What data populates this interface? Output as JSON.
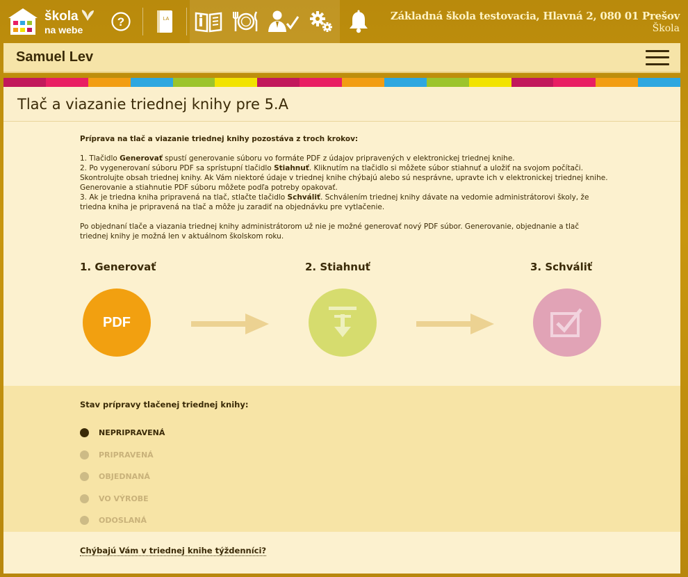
{
  "brand": {
    "line1": "škola",
    "line2": "na webe"
  },
  "topnav": [
    {
      "name": "help-icon"
    },
    {
      "name": "class-book-icon",
      "badge": "LA"
    },
    {
      "name": "reading-book-icon"
    },
    {
      "name": "dining-icon"
    },
    {
      "name": "teacher-check-icon"
    },
    {
      "name": "settings-gears-icon"
    },
    {
      "name": "notification-bell-icon"
    }
  ],
  "school": {
    "name": "Základná škola testovacia, Hlavná 2, 080 01 Prešov",
    "role": "Škola"
  },
  "user": {
    "name": "Samuel Lev"
  },
  "strip_colors": [
    "#c2185b",
    "#e91e63",
    "#f29d12",
    "#2ea7e0",
    "#9cc42c",
    "#f2e300",
    "#c2185b",
    "#e91e63",
    "#f29d12",
    "#2ea7e0",
    "#9cc42c",
    "#f2e300",
    "#c2185b",
    "#e91e63",
    "#f29d12",
    "#2ea7e0"
  ],
  "page": {
    "title": "Tlač a viazanie triednej knihy pre 5.A"
  },
  "instructions": {
    "intro": "Príprava na tlač a viazanie triednej knihy pozostáva z troch krokov:",
    "s1_pre": "1. Tlačidlo ",
    "s1_btn": "Generovať",
    "s1_post": " spustí generovanie súboru vo formáte PDF z údajov pripravených v elektronickej triednej knihe.",
    "s2_pre": "2. Po vygenerovaní súboru PDF sa sprístupní tlačidlo ",
    "s2_btn": "Stiahnuť",
    "s2_post": ". Kliknutím na tlačidlo si môžete súbor stiahnuť a uložiť na svojom počítači. Skontrolujte obsah triednej knihy. Ak Vám niektoré údaje v triednej knihe chýbajú alebo sú nesprávne, upravte ich v elektronickej triednej knihe. Generovanie a stiahnutie PDF súboru môžete podľa potreby opakovať.",
    "s3_pre": "3. Ak je triedna kniha pripravená na tlač, stlačte tlačidlo ",
    "s3_btn": "Schváliť",
    "s3_post": ". Schválením triednej knihy dávate na vedomie administrátorovi školy, že triedna kniha je pripravená na tlač a môže ju zaradiť na objednávku pre vytlačenie.",
    "note": "Po objednaní tlače a viazania triednej knihy administrátorom už nie je možné generovať nový PDF súbor. Generovanie, objednanie a tlač triednej knihy je možná len v aktuálnom školskom roku."
  },
  "steps": {
    "generate_label": "1. Generovať",
    "generate_text": "PDF",
    "download_label": "2. Stiahnuť",
    "approve_label": "3. Schváliť"
  },
  "status": {
    "heading": "Stav prípravy tlačenej triednej knihy:",
    "items": [
      "NEPRIPRAVENÁ",
      "PRIPRAVENÁ",
      "OBJEDNANÁ",
      "VO VÝROBE",
      "ODOSLANÁ"
    ],
    "active_index": 0
  },
  "footer_link": "Chýbajú Vám v triednej knihe týždenníci?"
}
